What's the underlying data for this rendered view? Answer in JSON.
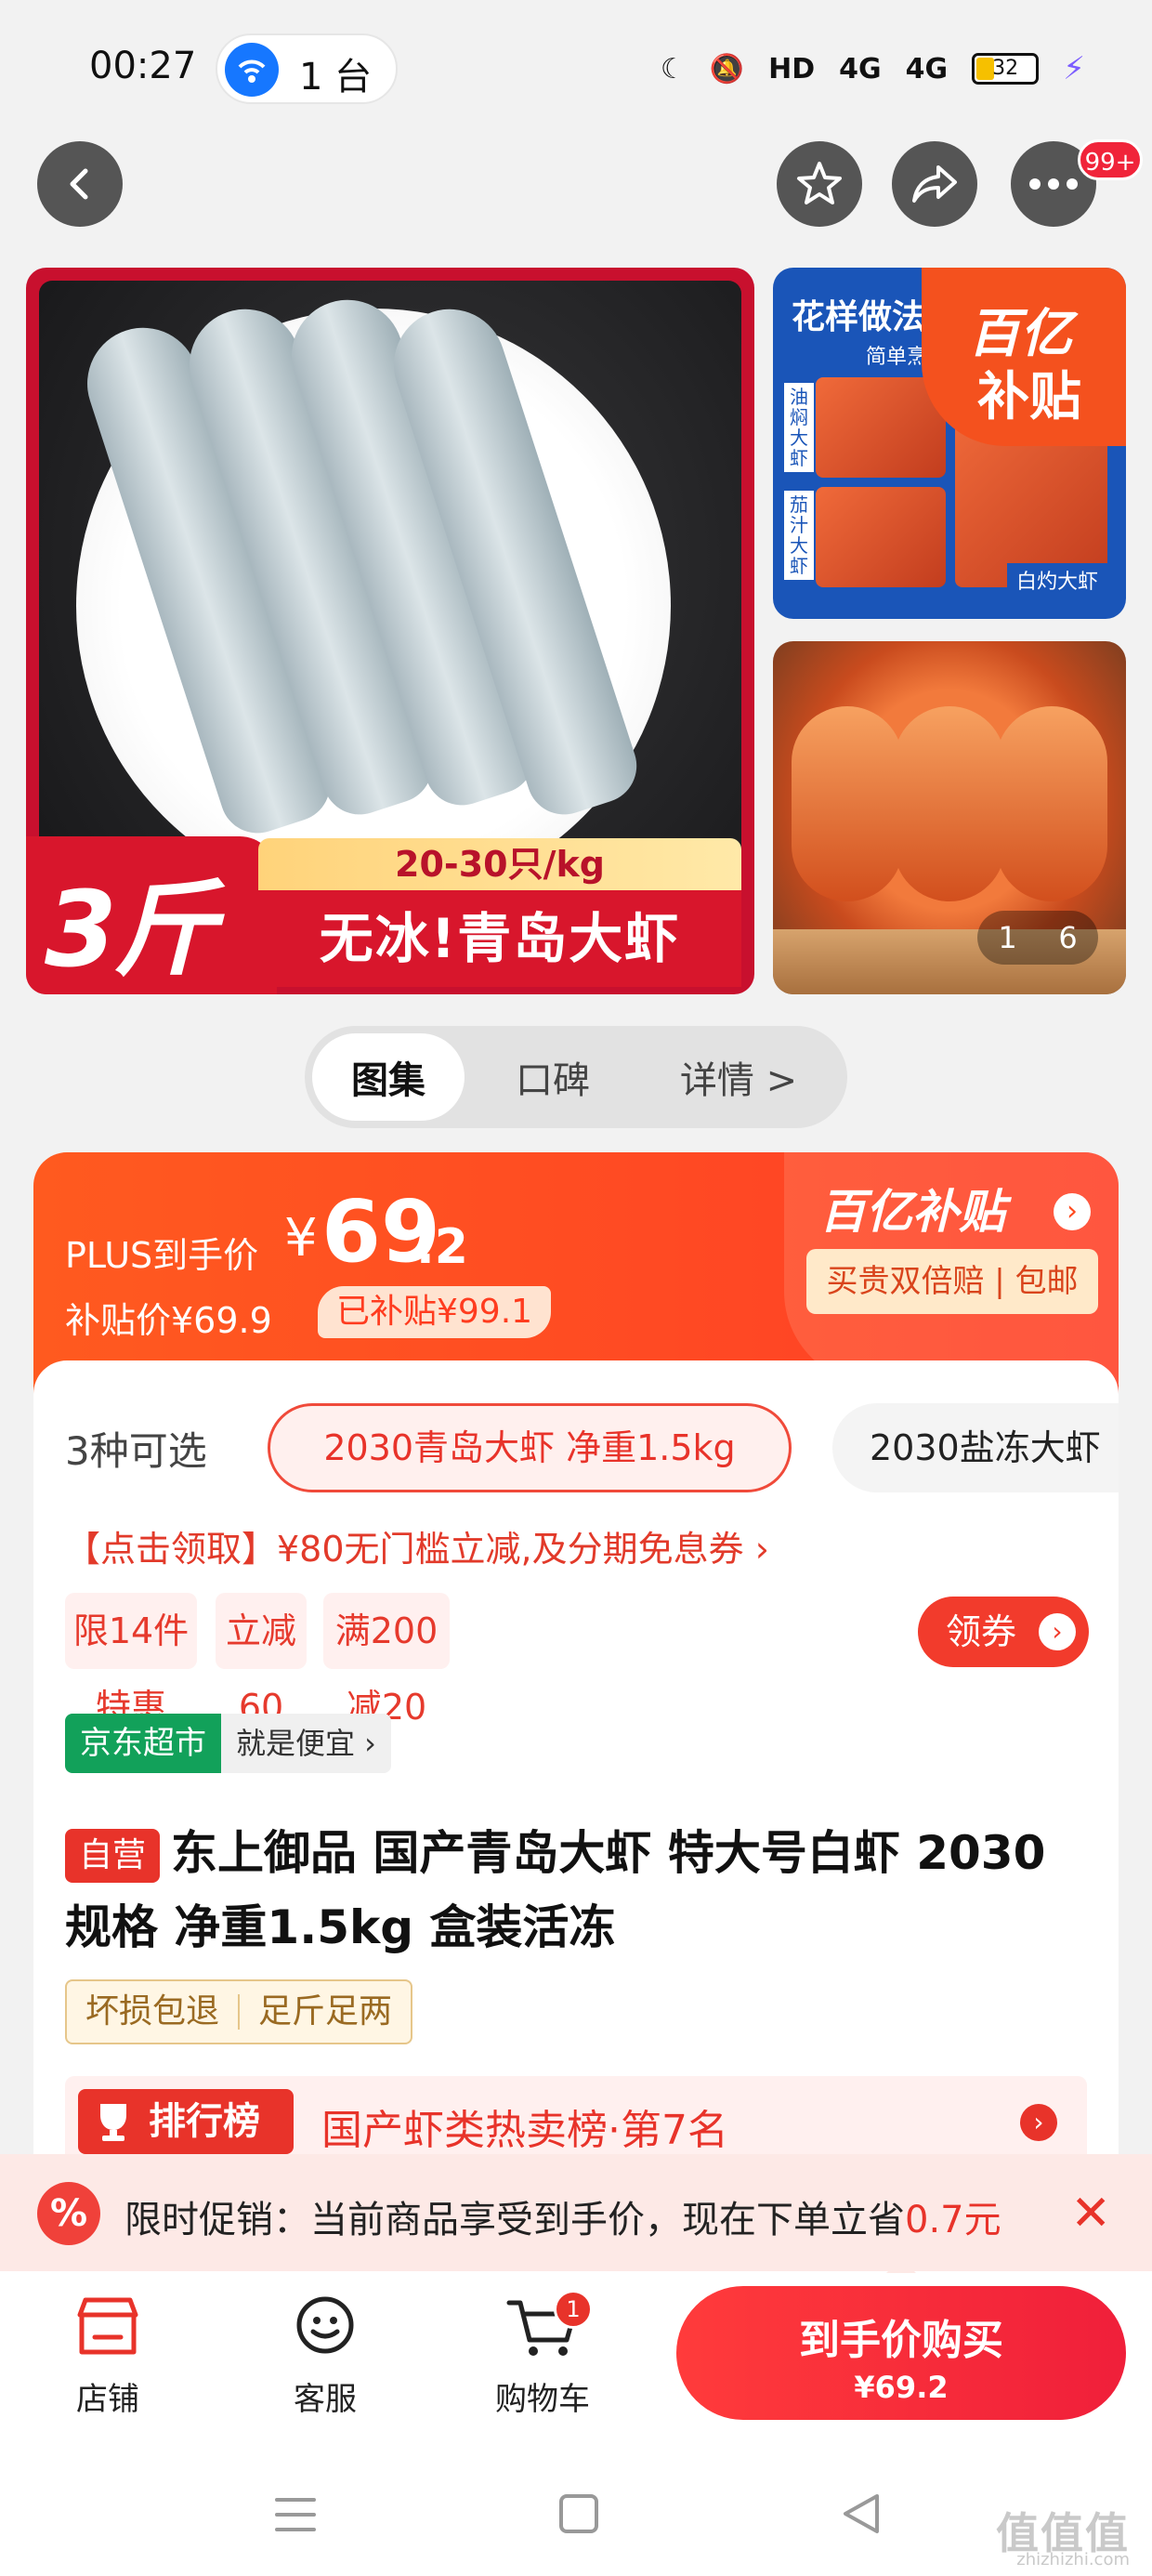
{
  "status_bar": {
    "time": "00:27",
    "hotspot_count": "1 台",
    "network": "HD",
    "signal1": "4G",
    "signal2": "4G",
    "battery": "32",
    "icons": [
      "moon-icon",
      "mute-icon",
      "hd-icon",
      "signal-icon",
      "signal-icon",
      "battery-icon",
      "charging-icon"
    ]
  },
  "nav": {
    "more_badge": "99+"
  },
  "gallery": {
    "main_weight_badge": "3斤",
    "main_spec": "20-30只/kg",
    "main_title": "无冰!青岛大虾",
    "side_header": "花样做法",
    "side_sub": "简单烹饪",
    "side_label1": "油焖大虾",
    "side_label2": "茄汁大虾",
    "side_label3": "白灼大虾",
    "yi_badge_line1": "百亿",
    "yi_badge_line2": "补贴",
    "pager_current": "1",
    "pager_total": "6"
  },
  "tabs": [
    "图集",
    "口碑",
    "详情 >"
  ],
  "price": {
    "plus_label": "PLUS到手价",
    "currency": "¥",
    "price_int": "69",
    "price_dec": ".2",
    "subsidy_label": "补贴价¥69.9",
    "subsidy_tag": "已补贴¥99.1",
    "brand": "百亿补贴",
    "service": "买贵双倍赔 | 包邮"
  },
  "options": {
    "count_label": "3种可选",
    "opt1": "2030青岛大虾 净重1.5kg",
    "opt2": "2030盐冻大虾"
  },
  "coupon": {
    "text": "【点击领取】¥80无门槛立减,及分期免息券 ›",
    "chips": [
      "限14件特惠",
      "立减60",
      "满200减20"
    ],
    "get_button": "领券"
  },
  "store": {
    "tag": "京东超市",
    "slogan": "就是便宜 ›"
  },
  "product": {
    "self_badge": "自营",
    "title": "东上御品 国产青岛大虾 特大号白虾 2030规格 净重1.5kg 盒装活冻",
    "guarantees": [
      "坏损包退",
      "足斤足两"
    ]
  },
  "rank": {
    "tag": "排行榜",
    "text": "国产虾类热卖榜·第7名"
  },
  "promo": {
    "icon": "%",
    "text_prefix": "限时促销：当前商品享受到手价，现在下单立省",
    "amount": "0.7元"
  },
  "bottom": {
    "store": "店铺",
    "service": "客服",
    "cart": "购物车",
    "cart_count": "1",
    "buy_line1": "到手价购买",
    "buy_line2": "¥69.2"
  },
  "watermark": {
    "main": "值值值",
    "sub": "zhizhizhi.com"
  },
  "colors": {
    "accent": "#f23b2c",
    "price_orange": "#ff4a1f",
    "jd_green": "#12a15a"
  }
}
